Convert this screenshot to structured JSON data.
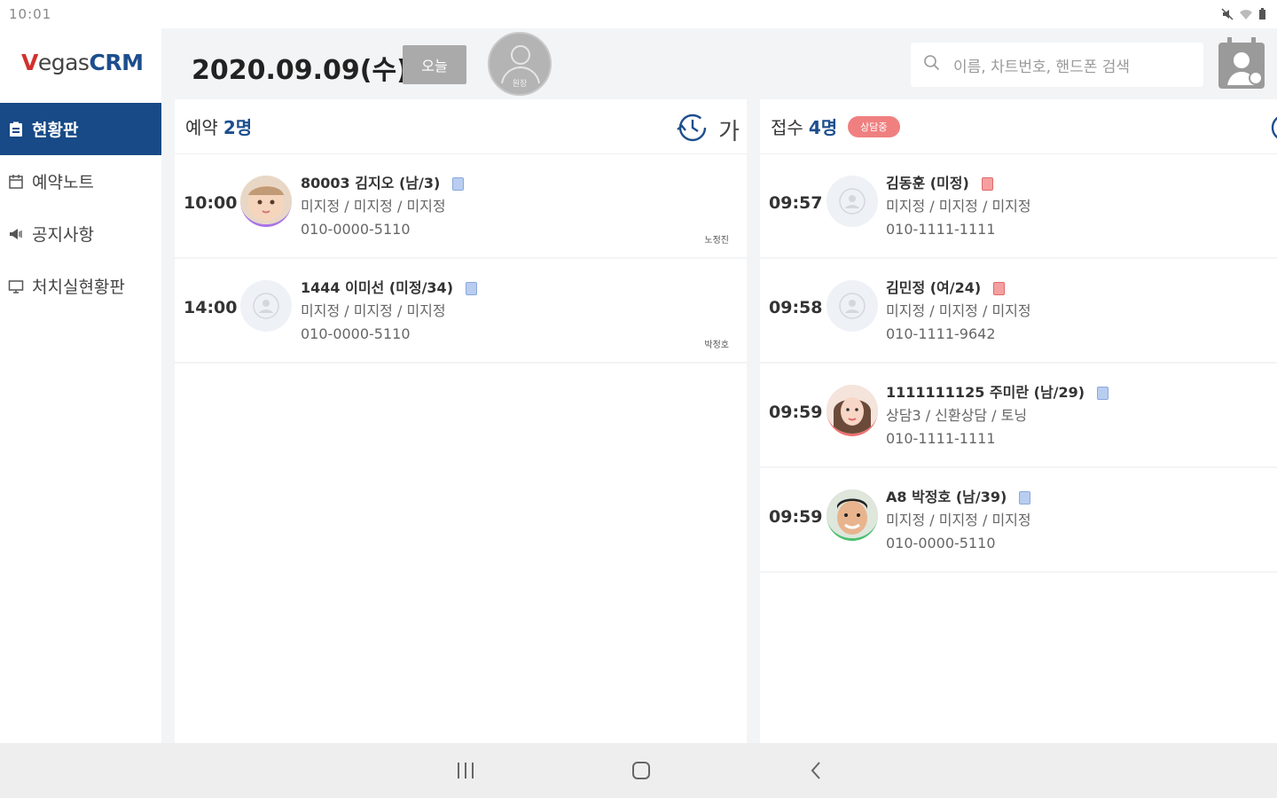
{
  "status_bar": {
    "time": "10:01"
  },
  "logo": {
    "part1": "V",
    "part2": "egas",
    "part3": "CRM"
  },
  "sidebar": {
    "items": [
      {
        "label": "현황판",
        "icon": "board-icon",
        "active": true
      },
      {
        "label": "예약노트",
        "icon": "calendar-icon",
        "active": false
      },
      {
        "label": "공지사항",
        "icon": "megaphone-icon",
        "active": false
      },
      {
        "label": "처치실현황판",
        "icon": "monitor-icon",
        "active": false
      }
    ]
  },
  "header": {
    "date": "2020.09.09(수)",
    "today_label": "오늘",
    "doctor_label": "원장",
    "search_placeholder": "이름, 차트번호, 핸드폰 검색"
  },
  "reservations": {
    "title": "예약",
    "count": "2명",
    "font_toggle": "가",
    "rows": [
      {
        "time": "10:00",
        "name": "80003 김지오 (남/3)",
        "sub": "미지정 / 미지정 / 미지정",
        "phone": "010-0000-5110",
        "tag": "노정진",
        "avatar": "baby-photo",
        "memo": "blue"
      },
      {
        "time": "14:00",
        "name": "1444 이미선 (미정/34)",
        "sub": "미지정 / 미지정 / 미지정",
        "phone": "010-0000-5110",
        "tag": "박정호",
        "avatar": "placeholder",
        "memo": "blue"
      }
    ]
  },
  "reception": {
    "title": "접수",
    "count": "4명",
    "badge": "상담중",
    "rows": [
      {
        "time": "09:57",
        "name": "김동훈 (미정)",
        "sub": "미지정 / 미지정 / 미지정",
        "phone": "010-1111-1111",
        "avatar": "placeholder",
        "memo": "red"
      },
      {
        "time": "09:58",
        "name": "김민정 (여/24)",
        "sub": "미지정 / 미지정 / 미지정",
        "phone": "010-1111-9642",
        "avatar": "placeholder",
        "memo": "red"
      },
      {
        "time": "09:59",
        "name": "1111111125 주미란 (남/29)",
        "sub": "상담3 / 신환상담 / 토닝",
        "phone": "010-1111-1111",
        "avatar": "woman-photo",
        "memo": "blue"
      },
      {
        "time": "09:59",
        "name": "A8 박정호 (남/39)",
        "sub": "미지정 / 미지정 / 미지정",
        "phone": "010-0000-5110",
        "avatar": "man-photo",
        "memo": "blue"
      }
    ]
  },
  "colors": {
    "brand_blue": "#174a86",
    "brand_red": "#d1312f",
    "badge": "#f08080"
  }
}
